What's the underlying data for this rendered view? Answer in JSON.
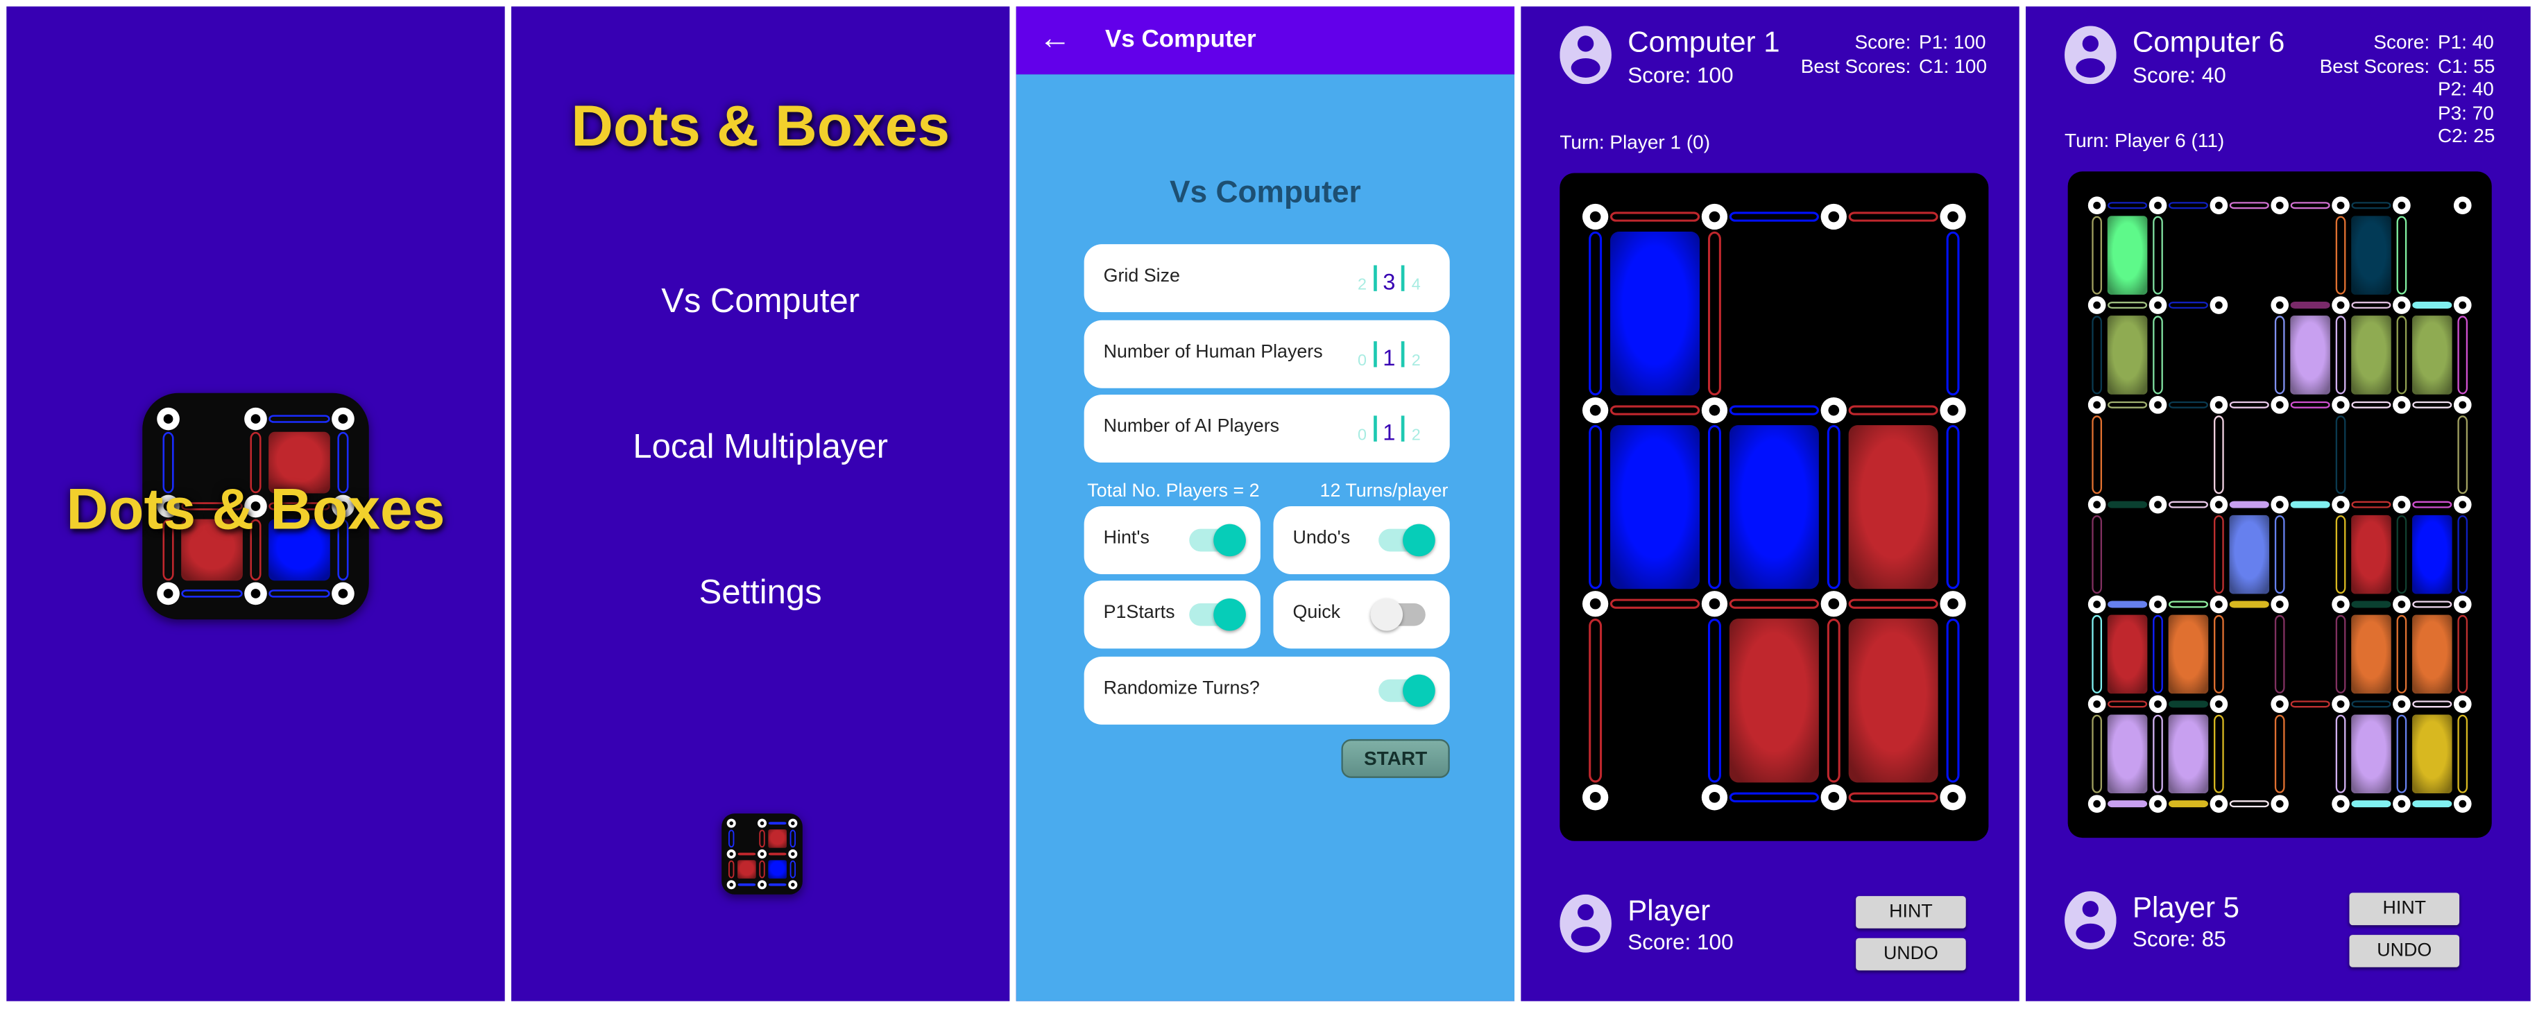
{
  "colors": {
    "background": "#3700b3",
    "appbar": "#6200ea",
    "setup_background": "#4aabee",
    "title_yellow": "#f2d02c",
    "accent_teal": "#06cdb8",
    "player_blue": "#0010ff",
    "player_red": "#c0272d"
  },
  "logo_board": {
    "size": 2,
    "h": [
      [
        null,
        "#1a2cff"
      ],
      [
        "#c0272d",
        "#c0272d"
      ],
      [
        "#1a2cff",
        "#1a2cff"
      ]
    ],
    "v": [
      [
        "#1a2cff",
        "#c0272d",
        "#1a2cff"
      ],
      [
        "#c0272d",
        "#c0272d",
        "#1a2cff"
      ]
    ],
    "boxes": [
      [
        null,
        "#c0272d"
      ],
      [
        "#c0272d",
        "#0010ff"
      ]
    ]
  },
  "splash": {
    "title": "Dots & Boxes"
  },
  "menu": {
    "title": "Dots & Boxes",
    "items": [
      {
        "label": "Vs Computer"
      },
      {
        "label": "Local Multiplayer"
      },
      {
        "label": "Settings"
      }
    ]
  },
  "setup": {
    "appbar_title": "Vs Computer",
    "back_icon": "arrow-left",
    "heading": "Vs Computer",
    "selectors": [
      {
        "label": "Grid Size",
        "options": [
          "2",
          "3",
          "4"
        ],
        "selected": "3"
      },
      {
        "label": "Number of Human Players",
        "options": [
          "0",
          "1",
          "2"
        ],
        "selected": "1"
      },
      {
        "label": "Number of AI Players",
        "options": [
          "0",
          "1",
          "2"
        ],
        "selected": "1"
      }
    ],
    "total_players": "Total No. Players = 2",
    "turns_per_player": "12 Turns/player",
    "toggles": [
      {
        "label": "Hint's",
        "on": true
      },
      {
        "label": "Undo's",
        "on": true
      },
      {
        "label": "P1Starts",
        "on": true
      },
      {
        "label": "Quick",
        "on": false
      },
      {
        "label": "Randomize Turns?",
        "on": true
      }
    ],
    "start_label": "START"
  },
  "games": [
    {
      "top_player": {
        "name": "Computer 1",
        "score": "Score: 100"
      },
      "score_label": "Score:",
      "best_label": "Best Scores:",
      "scores": [
        "P1: 100",
        "C1: 100"
      ],
      "turn": "Turn: Player 1 (0)",
      "bottom_player": {
        "name": "Player",
        "score": "Score: 100"
      },
      "hint_label": "HINT",
      "undo_label": "UNDO",
      "board": {
        "size": 3,
        "h": [
          [
            "#c0272d",
            "#0010ff",
            "#c0272d"
          ],
          [
            "#c0272d",
            "#0010ff",
            "#c0272d"
          ],
          [
            "#c0272d",
            "#c0272d",
            "#c0272d"
          ],
          [
            null,
            "#0010ff",
            "#c0272d"
          ]
        ],
        "v": [
          [
            "#0010ff",
            "#c0272d",
            null,
            "#0010ff"
          ],
          [
            "#0010ff",
            "#0010ff",
            "#0010ff",
            "#0010ff"
          ],
          [
            "#c0272d",
            "#0010ff",
            "#c0272d",
            "#0010ff"
          ]
        ],
        "boxes": [
          [
            "#0010ff",
            null,
            null
          ],
          [
            "#0010ff",
            "#0010ff",
            "#c0272d"
          ],
          [
            null,
            "#c0272d",
            "#c0272d"
          ]
        ]
      }
    },
    {
      "top_player": {
        "name": "Computer 6",
        "score": "Score: 40"
      },
      "score_label": "Score:",
      "best_label": "Best Scores:",
      "scores": [
        "P1: 40",
        "C1: 55",
        "P2: 40",
        "P3: 70",
        "C2: 25"
      ],
      "turn": "Turn: Player 6 (11)",
      "bottom_player": {
        "name": "Player 5",
        "score": "Score: 85"
      },
      "hint_label": "HINT",
      "undo_label": "UNDO",
      "board": {
        "size": 6,
        "h": [
          [
            "#1020c0",
            "#1020c0",
            "#d070d0",
            "#d070d0",
            "#0a3a50",
            null
          ],
          [
            "#a0c080",
            "#1020c0",
            null,
            {
              "c": "#7a2a6a",
              "solid": true
            },
            "#e0c0e0",
            {
              "c": "#80f0f0",
              "solid": true
            }
          ],
          [
            "#a0b070",
            "#0a3a50",
            "#e8c8e8",
            "#d050d0",
            "#f0d8f0",
            "#f0e0f0"
          ],
          [
            {
              "c": "#0a4030",
              "solid": true
            },
            "#e8c8e8",
            {
              "c": "#c8a0f0",
              "solid": true
            },
            {
              "c": "#80f0f0",
              "solid": true
            },
            "#c03030",
            "#d050d0"
          ],
          [
            {
              "c": "#6680ee",
              "solid": true
            },
            "#90f0a0",
            {
              "c": "#d8b820",
              "solid": true
            },
            null,
            {
              "c": "#0a4030",
              "solid": true
            },
            "#f0d8f0"
          ],
          [
            "#c03030",
            {
              "c": "#0a4030",
              "solid": true
            },
            null,
            "#c03030",
            "#0a3a50",
            "#f0d8f0"
          ],
          [
            {
              "c": "#c8a0f0",
              "solid": true
            },
            {
              "c": "#d8b820",
              "solid": true
            },
            "#f8e8f0",
            null,
            {
              "c": "#80f0f0",
              "solid": true
            },
            {
              "c": "#80f0f0",
              "solid": true
            }
          ]
        ],
        "v": [
          [
            "#a0a060",
            "#80e0a0",
            null,
            null,
            "#e07030",
            "#80f0a0",
            null
          ],
          [
            "#0a3a50",
            "#80e0a0",
            null,
            "#8090f0",
            "#d0b0f0",
            "#90a050",
            "#d050d0"
          ],
          [
            "#e07030",
            null,
            "#f0d0e0",
            null,
            "#0a3a50",
            null,
            "#a0a060"
          ],
          [
            "#803060",
            null,
            "#c03030",
            "#6680ee",
            "#d8b820",
            "#104030",
            "#1020c0"
          ],
          [
            "#80f0f0",
            "#1020ff",
            "#e07030",
            "#803060",
            "#803060",
            "#e07030",
            "#c03030"
          ],
          [
            "#a0a060",
            "#d0b0f0",
            "#d8b820",
            "#e07030",
            "#d0b0f0",
            "#6680ee",
            "#d8b820"
          ]
        ],
        "boxes": [
          [
            "#5ef98a",
            null,
            null,
            null,
            "#023a56",
            null
          ],
          [
            "#8fab52",
            null,
            null,
            "#c8a0f0",
            "#8fab52",
            "#8fab52"
          ],
          [
            null,
            null,
            null,
            null,
            null,
            null
          ],
          [
            null,
            null,
            "#6680ee",
            null,
            "#c0272d",
            "#0010ff"
          ],
          [
            "#c0272d",
            "#e07030",
            null,
            null,
            "#e07030",
            "#e07030"
          ],
          [
            "#c8a0f0",
            "#c8a0f0",
            null,
            null,
            "#c8a0f0",
            "#d8b820"
          ]
        ]
      }
    }
  ]
}
